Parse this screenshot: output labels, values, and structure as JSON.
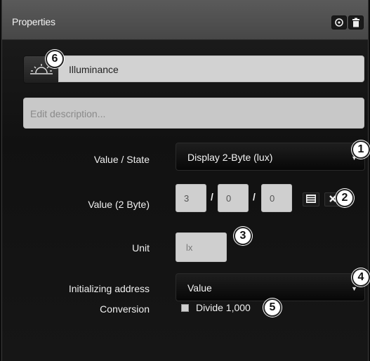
{
  "header": {
    "title": "Properties",
    "settings_icon": "gear-icon",
    "delete_icon": "trash-icon"
  },
  "name_field": {
    "icon": "sun-illuminance-icon",
    "value": "Illuminance"
  },
  "description_field": {
    "placeholder": "Edit description..."
  },
  "value_state": {
    "label": "Value / State",
    "selected": "Display 2-Byte (lux)"
  },
  "value_2byte": {
    "label": "Value (2 Byte)",
    "parts": [
      "3",
      "0",
      "0"
    ],
    "separator": "/",
    "list_icon": "list-icon",
    "clear_icon": "close-icon"
  },
  "unit": {
    "label": "Unit",
    "value": "lx"
  },
  "initializing_address": {
    "label": "Initializing address",
    "selected": "Value"
  },
  "conversion": {
    "label": "Conversion",
    "checkbox_label": "Divide 1,000",
    "checked": false
  },
  "callouts": [
    "1",
    "2",
    "3",
    "4",
    "5",
    "6"
  ],
  "colors": {
    "header": "#4e4e4e",
    "panel": "#121212",
    "input": "#d2d2d2"
  }
}
